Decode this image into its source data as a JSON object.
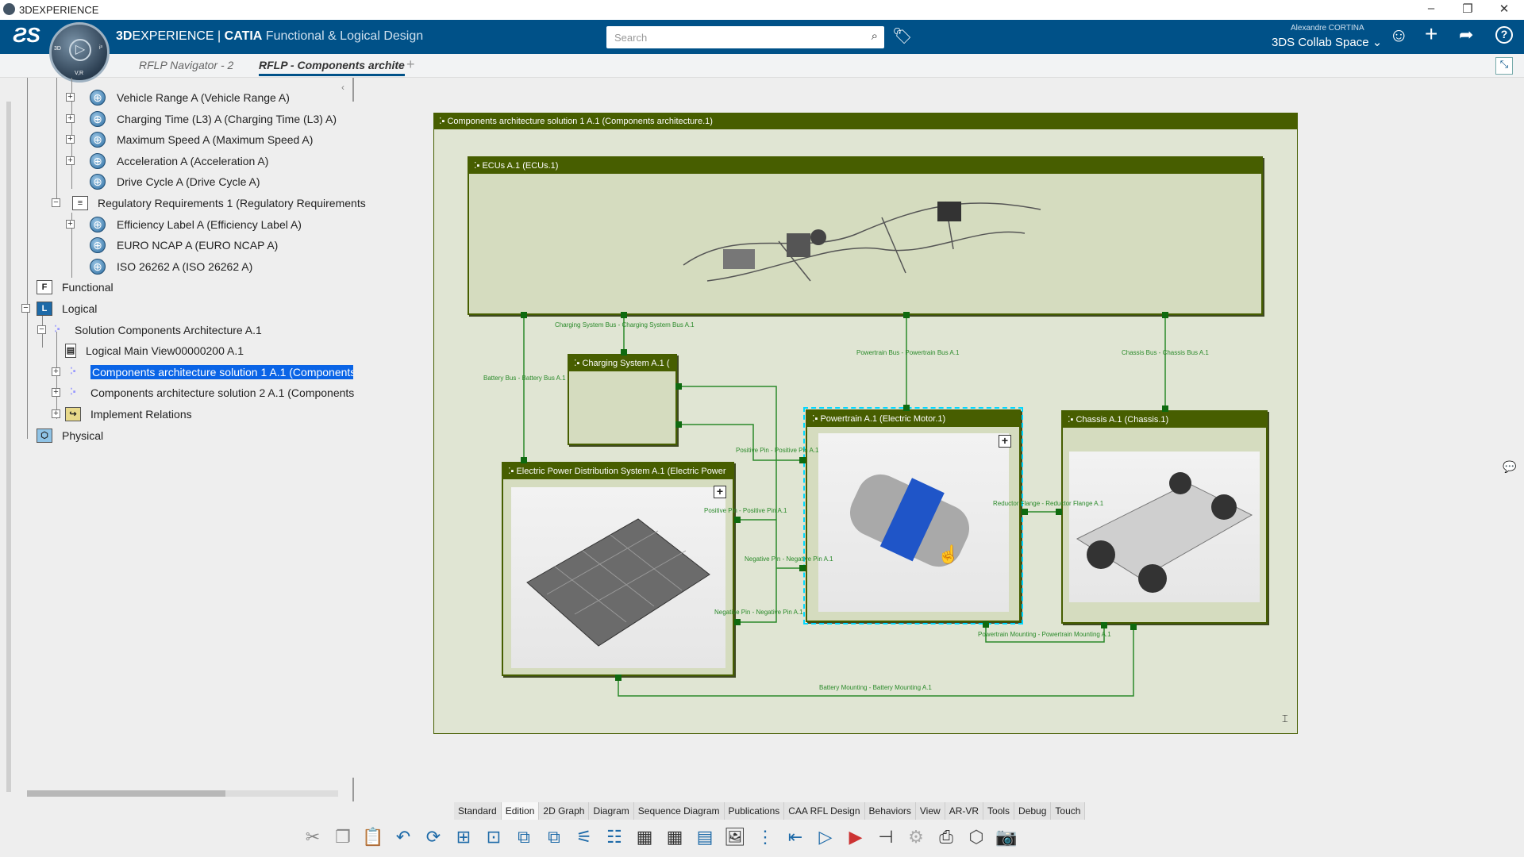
{
  "window": {
    "title": "3DEXPERIENCE",
    "min": "–",
    "max": "❐",
    "close": "✕"
  },
  "header": {
    "brand_bold": "3D",
    "brand": "EXPERIENCE | ",
    "product": "CATIA",
    "app": "Functional & Logical Design",
    "search_placeholder": "Search",
    "user": "Alexandre CORTINA",
    "collab_space": "3DS Collab Space",
    "compass_labels": {
      "left": "3D",
      "right": "i³",
      "bottom": "V,R"
    }
  },
  "tabs": [
    {
      "label": "RFLP Navigator - 2",
      "active": false
    },
    {
      "label": "RFLP - Components archite",
      "active": true
    }
  ],
  "tree": {
    "items": [
      "Vehicle Range A (Vehicle Range A)",
      "Charging Time (L3) A (Charging Time (L3) A)",
      "Maximum Speed A (Maximum Speed A)",
      "Acceleration A (Acceleration A)",
      "Drive Cycle A (Drive Cycle A)",
      "Regulatory Requirements 1 (Regulatory Requirements",
      "Efficiency Label A (Efficiency Label A)",
      "EURO NCAP A (EURO NCAP A)",
      "ISO 26262 A (ISO 26262 A)",
      "Functional",
      "Logical",
      "Solution Components Architecture A.1",
      "Logical Main View00000200 A.1",
      "Components architecture solution 1 A.1 (Components",
      "Components architecture solution 2 A.1 (Components",
      "Implement Relations",
      "Physical"
    ],
    "selected": "Components architecture solution 1 A.1 (Components",
    "icons": {
      "functional": "F",
      "logical": "L"
    }
  },
  "diagram": {
    "title": "Components architecture solution 1 A.1 (Components architecture.1)",
    "blocks": {
      "ecus": "ECUs A.1 (ECUs.1)",
      "charging": "Charging System A.1 (",
      "epds": "Electric Power Distribution System A.1 (Electric Power",
      "powertrain": "Powertrain A.1 (Electric Motor.1)",
      "chassis": "Chassis A.1 (Chassis.1)"
    },
    "wires": {
      "charging_bus": "Charging System Bus - Charging System Bus A.1",
      "battery_bus": "Battery Bus - Battery Bus A.1",
      "powertrain_bus": "Powertrain Bus - Powertrain Bus A.1",
      "chassis_bus": "Chassis Bus - Chassis Bus A.1",
      "positive_pin": "Positive Pin - Positive Pin A.1",
      "negative_pin": "Negative Pin - Negative Pin A.1",
      "reductor": "Reductor Flange - Reductor Flange A.1",
      "pt_mount": "Powertrain Mounting - Powertrain Mounting A.1",
      "bat_mount": "Battery Mounting - Battery Mounting A.1"
    },
    "wire_color": "#2a8a2a",
    "header_color": "#475e00",
    "selection_color": "#00d8ff"
  },
  "command_tabs": [
    "Standard",
    "Edition",
    "2D Graph",
    "Diagram",
    "Sequence Diagram",
    "Publications",
    "CAA RFL Design",
    "Behaviors",
    "View",
    "AR-VR",
    "Tools",
    "Debug",
    "Touch"
  ],
  "active_command_tab": "Edition"
}
